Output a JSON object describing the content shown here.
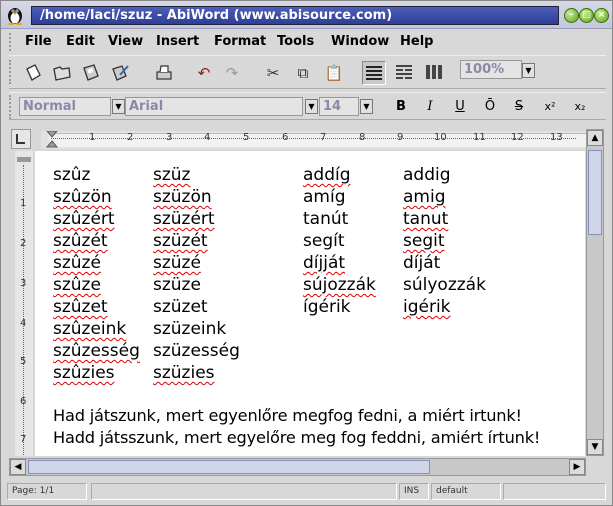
{
  "window": {
    "title": "/home/laci/szuz - AbiWord (www.abisource.com)"
  },
  "menubar": {
    "items": [
      "File",
      "Edit",
      "View",
      "Insert",
      "Format",
      "Tools",
      "Window",
      "Help"
    ]
  },
  "toolbar": {
    "zoom": "100%"
  },
  "format_toolbar": {
    "style": "Normal",
    "font": "Arial",
    "size": "14",
    "bold": "B",
    "italic": "I",
    "underline": "U",
    "overline": "Ō",
    "strike": "S",
    "superscript": "x²",
    "subscript": "x₂"
  },
  "ruler": {
    "h_numbers": [
      "1",
      "2",
      "3",
      "4",
      "5",
      "6",
      "7",
      "8",
      "9",
      "10",
      "11",
      "12",
      "13"
    ],
    "v_numbers": [
      "1",
      "2",
      "3",
      "4",
      "5",
      "6",
      "7"
    ]
  },
  "document": {
    "col1": [
      "szûz",
      "szûzön",
      "szûzért",
      "szûzét",
      "szûzé",
      "szûze",
      "szûzet",
      "szûzeink",
      "szûzesség",
      "szûzies"
    ],
    "col2": [
      "szüz",
      "szüzön",
      "szüzért",
      "szüzét",
      "szüzé",
      "szüze",
      "szüzet",
      "szüzeink",
      "szüzesség",
      "szüzies"
    ],
    "col3": [
      "addíg",
      "amíg",
      "tanút",
      "segít",
      "díjját",
      "sújozzák",
      "ígérik"
    ],
    "col4": [
      "addig",
      "amig",
      "tanut",
      "segit",
      "díját",
      "súlyozzák",
      "igérik"
    ],
    "sentence1": "Had játszunk, mert egyenlőre megfog fedni, a miért irtunk!",
    "sentence2": "Hadd játsszunk, mert egyelőre meg fog feddni, amiért írtunk!"
  },
  "status": {
    "page": "Page: 1/1",
    "mode": "INS",
    "lang": "default"
  }
}
